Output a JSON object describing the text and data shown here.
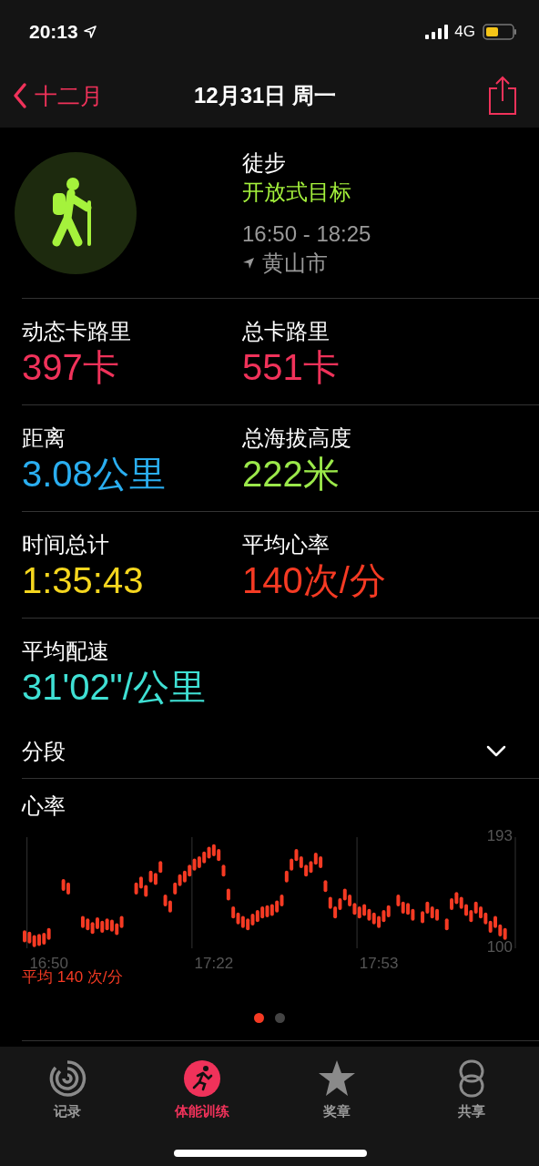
{
  "status_bar": {
    "time": "20:13",
    "network": "4G"
  },
  "nav": {
    "back": "十二月",
    "title": "12月31日 周一"
  },
  "workout": {
    "name": "徒步",
    "goal": "开放式目标",
    "time_range": "16:50 - 18:25",
    "location": "黄山市"
  },
  "metrics": [
    {
      "label": "动态卡路里",
      "value": "397卡",
      "color": "#f0325a"
    },
    {
      "label": "总卡路里",
      "value": "551卡",
      "color": "#f0325a"
    },
    {
      "label": "距离",
      "value": "3.08公里",
      "color": "#2aaef0"
    },
    {
      "label": "总海拔高度",
      "value": "222米",
      "color": "#9be84a"
    },
    {
      "label": "时间总计",
      "value": "1:35:43",
      "color": "#f5d61e"
    },
    {
      "label": "平均心率",
      "value": "140次/分",
      "color": "#f53a23"
    },
    {
      "label": "平均配速",
      "value": "31'02\"/公里",
      "color": "#3fe0d4"
    }
  ],
  "splits": {
    "label": "分段",
    "expanded": false
  },
  "heart_rate": {
    "average": "平均 140 次/分",
    "chart_data": {
      "type": "scatter",
      "title": "心率",
      "categories": [
        null,
        null,
        null,
        null,
        null,
        "16:50",
        null,
        null,
        null,
        null,
        null,
        null,
        null,
        null,
        null,
        null,
        null,
        null,
        null,
        null,
        null,
        null,
        null,
        null,
        null,
        null,
        null,
        null,
        null,
        null,
        null,
        null,
        null,
        null,
        null,
        null,
        null,
        null,
        null,
        "17:22",
        null,
        null,
        null,
        null,
        null,
        null,
        null,
        null,
        null,
        null,
        null,
        null,
        null,
        null,
        null,
        null,
        null,
        null,
        null,
        null,
        null,
        null,
        null,
        null,
        null,
        null,
        null,
        null,
        null,
        null,
        null,
        null,
        null,
        "17:53",
        null,
        null,
        null,
        null,
        null,
        null,
        null,
        null,
        null,
        null,
        null,
        null,
        null,
        null,
        null,
        null,
        null,
        null,
        null,
        null,
        null,
        null,
        null,
        null,
        null,
        null
      ],
      "ylim": [
        100,
        193
      ],
      "yticks": [
        100,
        193
      ],
      "series": [
        {
          "color": "#f53a23",
          "values": [
            110,
            109,
            106,
            107,
            108,
            112,
            null,
            null,
            153,
            150,
            null,
            null,
            122,
            120,
            117,
            121,
            118,
            120,
            119,
            116,
            122,
            null,
            null,
            150,
            155,
            148,
            160,
            158,
            168,
            140,
            135,
            150,
            157,
            160,
            165,
            170,
            172,
            176,
            180,
            182,
            178,
            165,
            145,
            130,
            125,
            122,
            120,
            124,
            127,
            130,
            131,
            132,
            135,
            140,
            160,
            170,
            178,
            172,
            165,
            168,
            175,
            172,
            152,
            138,
            130,
            137,
            145,
            140,
            133,
            130,
            132,
            128,
            125,
            122,
            127,
            131,
            null,
            140,
            134,
            133,
            128,
            null,
            126,
            134,
            130,
            128,
            null,
            120,
            137,
            142,
            138,
            132,
            127,
            134,
            130,
            125,
            118,
            122,
            115,
            112
          ]
        }
      ]
    }
  },
  "pager": [
    {
      "selected": true
    },
    {
      "selected": false
    }
  ],
  "tabs": [
    {
      "label": "记录",
      "selected": false,
      "kind": "rings"
    },
    {
      "label": "体能训练",
      "selected": true,
      "kind": "runner"
    },
    {
      "label": "奖章",
      "selected": false,
      "kind": "star"
    },
    {
      "label": "共享",
      "selected": false,
      "kind": "share"
    }
  ]
}
